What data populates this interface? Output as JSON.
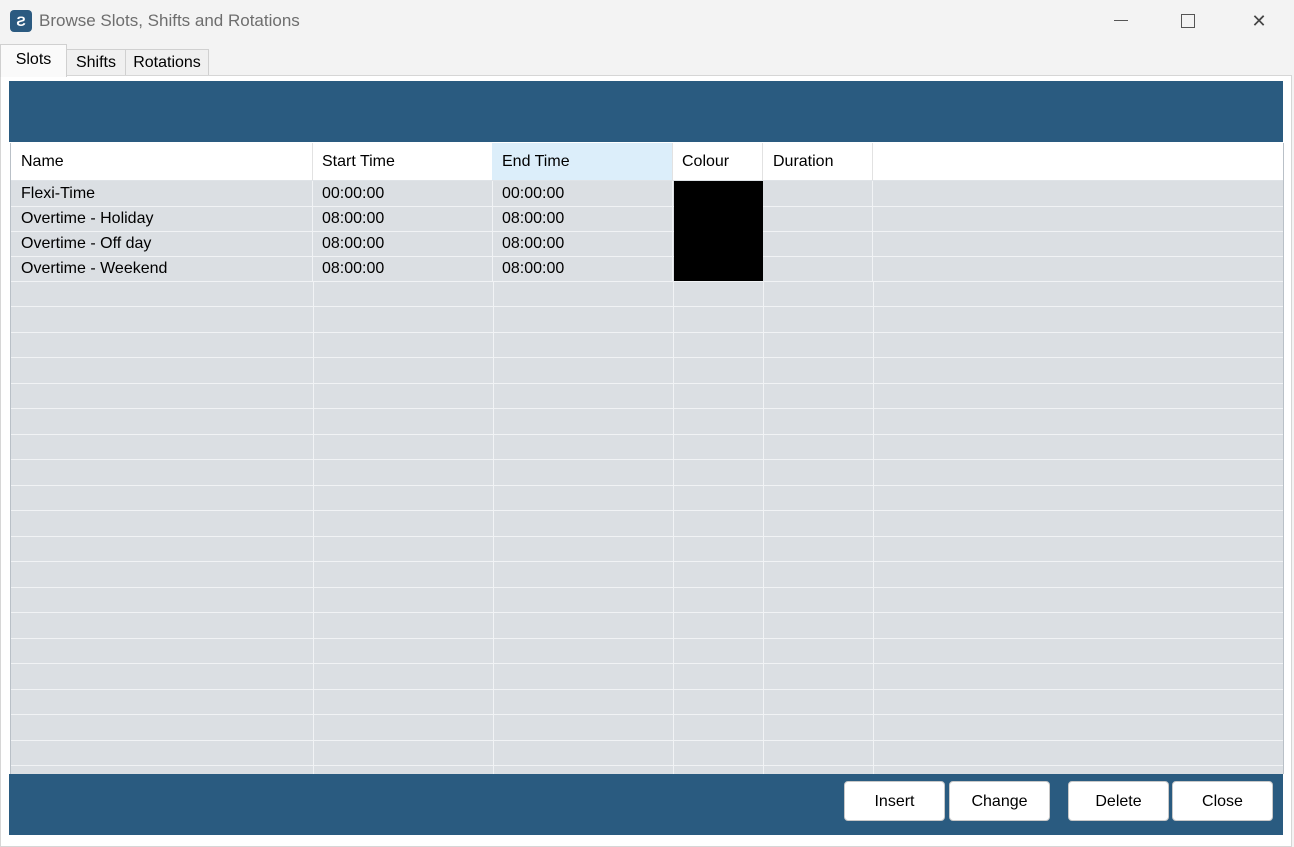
{
  "window": {
    "title": "Browse Slots, Shifts and Rotations",
    "icon": "app-logo-icon",
    "controls": [
      "minimize-icon",
      "maximize-icon",
      "close-icon"
    ]
  },
  "tabs": [
    {
      "label": "Slots",
      "active": true
    },
    {
      "label": "Shifts",
      "active": false
    },
    {
      "label": "Rotations",
      "active": false
    }
  ],
  "grid": {
    "columns": [
      "Name",
      "Start Time",
      "End Time",
      "Colour",
      "Duration",
      ""
    ],
    "selected_column": "End Time",
    "rows": [
      {
        "name": "Flexi-Time",
        "start": "00:00:00",
        "end": "00:00:00",
        "colour": "#000000",
        "duration": ""
      },
      {
        "name": "Overtime - Holiday",
        "start": "08:00:00",
        "end": "08:00:00",
        "colour": "#000000",
        "duration": ""
      },
      {
        "name": "Overtime - Off day",
        "start": "08:00:00",
        "end": "08:00:00",
        "colour": "#000000",
        "duration": ""
      },
      {
        "name": "Overtime - Weekend",
        "start": "08:00:00",
        "end": "08:00:00",
        "colour": "#000000",
        "duration": ""
      }
    ]
  },
  "buttons": {
    "insert": "Insert",
    "change": "Change",
    "delete": "Delete",
    "close": "Close"
  },
  "colors": {
    "bar": "#2a5b80",
    "grid": "#dbdfe3",
    "header_selected": "#dceefa"
  }
}
